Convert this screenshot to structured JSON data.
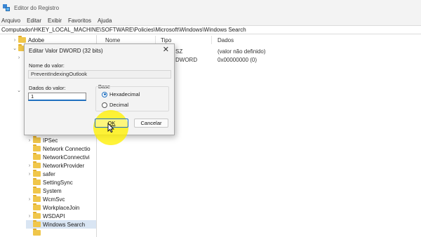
{
  "window": {
    "title": "Editor do Registro"
  },
  "menu": [
    "Arquivo",
    "Editar",
    "Exibir",
    "Favoritos",
    "Ajuda"
  ],
  "address": "Computador\\HKEY_LOCAL_MACHINE\\SOFTWARE\\Policies\\Microsoft\\Windows\\Windows Search",
  "tree": {
    "items": [
      {
        "label": "Adobe",
        "chevron": "›"
      },
      {
        "label": "",
        "chevron": "⌄"
      },
      {
        "label": "",
        "chevron": "›"
      },
      {
        "label": "",
        "chevron": "⌄"
      },
      {
        "label": "IPSec",
        "chevron": "›"
      },
      {
        "label": "Network Connectio",
        "chevron": ""
      },
      {
        "label": "NetworkConnectivi",
        "chevron": ""
      },
      {
        "label": "NetworkProvider",
        "chevron": "›"
      },
      {
        "label": "safer",
        "chevron": "›"
      },
      {
        "label": "SettingSync",
        "chevron": ""
      },
      {
        "label": "System",
        "chevron": ""
      },
      {
        "label": "WcmSvc",
        "chevron": "›"
      },
      {
        "label": "WorkplaceJoin",
        "chevron": ""
      },
      {
        "label": "WSDAPI",
        "chevron": "›"
      },
      {
        "label": "Windows Search",
        "chevron": ""
      }
    ]
  },
  "list": {
    "columns": [
      "Nome",
      "Tipo",
      "Dados"
    ],
    "rows": [
      {
        "type_tail": "SZ",
        "data": "(valor não definido)"
      },
      {
        "type_tail": "DWORD",
        "data": "0x00000000 (0)"
      }
    ]
  },
  "dialog": {
    "title": "Editar Valor DWORD (32 bits)",
    "close_glyph": "✕",
    "value_name_label": "Nome do valor:",
    "value_name": "PreventIndexingOutlook",
    "value_data_label": "Dados do valor:",
    "value_data": "1",
    "base_label": "Base",
    "base_options": [
      "Hexadecimal",
      "Decimal"
    ],
    "selected_base": "Hexadecimal",
    "ok_label": "OK",
    "cancel_label": "Cancelar"
  },
  "icons": {
    "app": "registry-editor-icon",
    "folder": "folder-icon",
    "cursor": "mouse-pointer-icon"
  },
  "colors": {
    "accent": "#1f6fbf",
    "folder": "#f0c64a",
    "selection": "#d9e5f3",
    "highlight": "#fff000"
  }
}
